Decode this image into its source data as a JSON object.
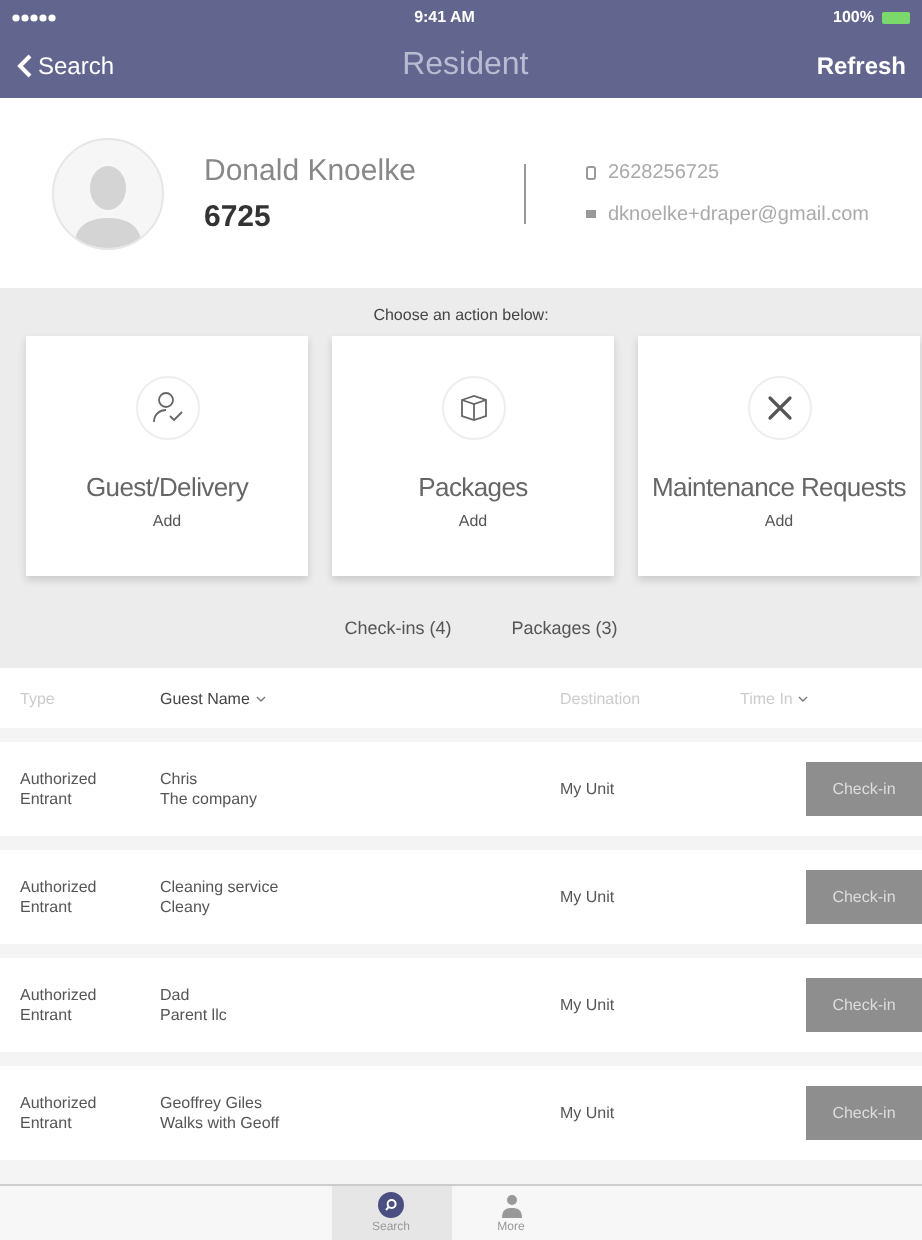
{
  "status_bar": {
    "time": "9:41 AM",
    "battery": "100%"
  },
  "nav": {
    "back": "Search",
    "title": "Resident",
    "action": "Refresh"
  },
  "profile": {
    "name": "Donald Knoelke",
    "unit": "6725",
    "phone": "2628256725",
    "email": "dknoelke+draper@gmail.com"
  },
  "actions_prompt": "Choose an action below:",
  "actions": [
    {
      "kind": "guest",
      "title": "Guest/Delivery",
      "subtitle": "Add"
    },
    {
      "kind": "package",
      "title": "Packages",
      "subtitle": "Add"
    },
    {
      "kind": "maintenance",
      "title": "Maintenance Requests",
      "subtitle": "Add"
    }
  ],
  "list_tabs": [
    "Check-ins (4)",
    "Packages (3)"
  ],
  "table": {
    "columns": [
      {
        "label": "Type",
        "sortable": false
      },
      {
        "label": "Guest Name",
        "sortable": true
      },
      {
        "label": "Destination",
        "sortable": false
      },
      {
        "label": "Time In",
        "sortable": true
      }
    ],
    "rows": [
      {
        "type": "Authorized Entrant",
        "guest": "Chris",
        "company": "The company",
        "destination": "My Unit",
        "button": "Check-in"
      },
      {
        "type": "Authorized Entrant",
        "guest": "Cleaning service",
        "company": "Cleany",
        "destination": "My Unit",
        "button": "Check-in"
      },
      {
        "type": "Authorized Entrant",
        "guest": "Dad",
        "company": "Parent llc",
        "destination": "My Unit",
        "button": "Check-in"
      },
      {
        "type": "Authorized Entrant",
        "guest": "Geoffrey Giles",
        "company": "Walks with Geoff",
        "destination": "My Unit",
        "button": "Check-in"
      }
    ]
  },
  "tab_bar": [
    {
      "kind": "search",
      "label": "Search",
      "selected": true
    },
    {
      "kind": "more",
      "label": "More",
      "selected": false
    }
  ]
}
